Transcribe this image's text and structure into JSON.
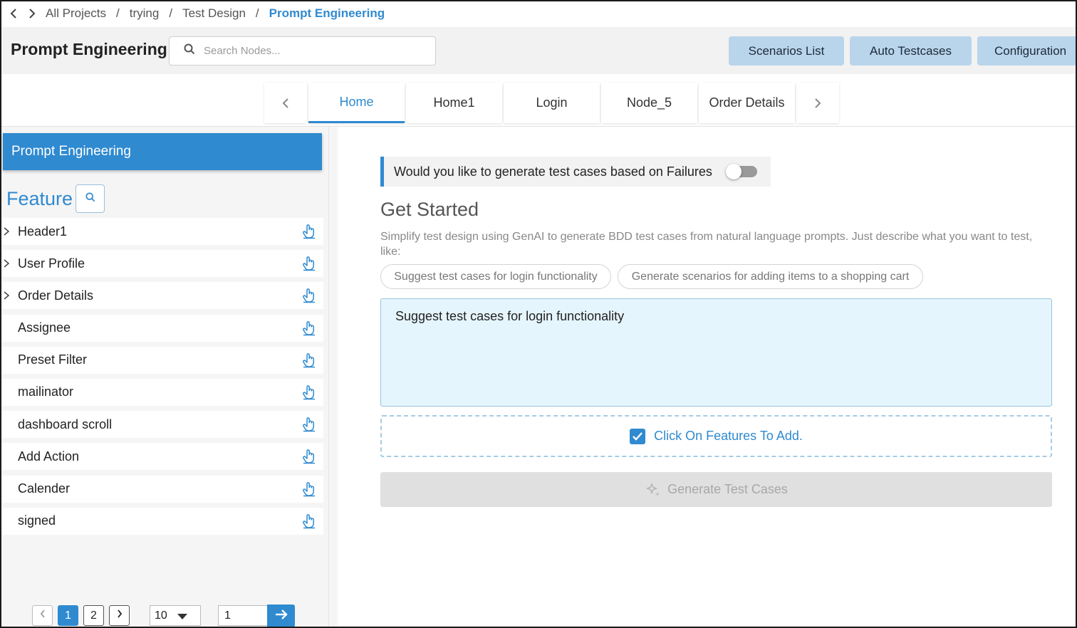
{
  "breadcrumb": {
    "items": [
      "All Projects",
      "trying",
      "Test Design"
    ],
    "current": "Prompt Engineering",
    "separator": "/"
  },
  "header": {
    "title": "Prompt Engineering",
    "search_placeholder": "Search Nodes...",
    "buttons": [
      "Scenarios List",
      "Auto Testcases",
      "Configuration"
    ]
  },
  "tabs": {
    "items": [
      "Home",
      "Home1",
      "Login",
      "Node_5",
      "Order Details"
    ],
    "active": "Home"
  },
  "sidebar": {
    "header": "Prompt Engineering",
    "feature_title": "Feature",
    "items": [
      {
        "label": "Header1",
        "expandable": true
      },
      {
        "label": "User Profile",
        "expandable": true
      },
      {
        "label": "Order Details",
        "expandable": true
      },
      {
        "label": "Assignee",
        "expandable": false
      },
      {
        "label": "Preset Filter",
        "expandable": false
      },
      {
        "label": "mailinator",
        "expandable": false
      },
      {
        "label": "dashboard scroll",
        "expandable": false
      },
      {
        "label": "Add Action",
        "expandable": false
      },
      {
        "label": "Calender",
        "expandable": false
      },
      {
        "label": "signed",
        "expandable": false
      }
    ],
    "pagination": {
      "pages": [
        "1",
        "2"
      ],
      "current_page": "1",
      "page_size": "10",
      "goto_value": "1"
    }
  },
  "main": {
    "failure_prompt": "Would you like to generate test cases based on Failures",
    "failure_toggle_on": false,
    "heading": "Get Started",
    "intro": "Simplify test design using GenAI to generate BDD test cases from natural language prompts. Just describe what you want to test, like:",
    "suggestions": [
      "Suggest test cases for login functionality",
      "Generate scenarios for adding items to a shopping cart"
    ],
    "prompt_value": "Suggest test cases for login functionality",
    "features_add": "Click On Features To Add.",
    "generate_label": "Generate Test Cases"
  },
  "colors": {
    "accent": "#2f8ad0",
    "header_button": "#b9d5ec",
    "prompt_bg": "#e5f5fd",
    "disabled_button": "#e0e0e0"
  }
}
